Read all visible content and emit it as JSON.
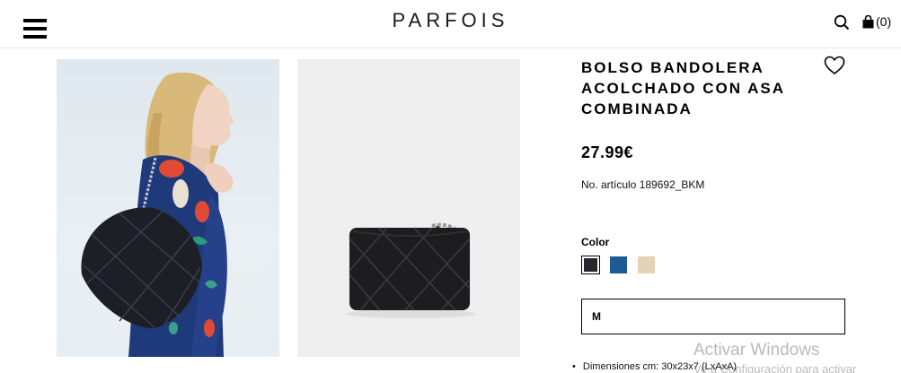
{
  "header": {
    "logo": "PARFOIS",
    "cart_count": "(0)"
  },
  "product": {
    "title": "BOLSO BANDOLERA ACOLCHADO CON ASA COMBINADA",
    "price": "27.99€",
    "article": "No. artículo 189692_BKM",
    "color_label": "Color",
    "colors": [
      "#24272c",
      "#1e5a94",
      "#e3d3b7"
    ],
    "selected_color_index": 0,
    "size_value": "M",
    "dimensions": "Dimensiones cm: 30x23x7 (LxAxA)"
  },
  "watermark": {
    "line1": "Activar Windows",
    "line2": "Ve a Configuración para activar"
  },
  "icons": {
    "menu": "hamburger-icon",
    "search": "search-icon",
    "cart": "shopping-bag-icon",
    "wishlist": "heart-icon"
  }
}
